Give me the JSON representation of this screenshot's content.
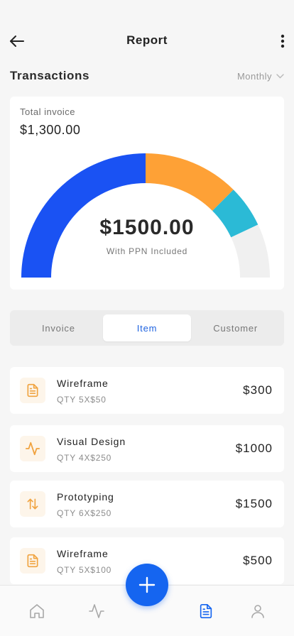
{
  "header": {
    "title": "Report",
    "back_icon": "arrow-left-icon",
    "more_icon": "more-vertical-icon"
  },
  "section": {
    "title": "Transactions",
    "period": "Monthly"
  },
  "summary": {
    "label": "Total invoice",
    "value": "$1,300.00",
    "gauge_total": "$1500.00",
    "gauge_subtitle": "With PPN Included",
    "gauge_segments": [
      {
        "fraction": 0.5,
        "color": "#1a52f3"
      },
      {
        "fraction": 0.25,
        "color": "#fea136"
      },
      {
        "fraction": 0.11,
        "color": "#2bbad6"
      },
      {
        "fraction": 0.14,
        "color": "#f0f0f0"
      }
    ]
  },
  "tabs": [
    {
      "label": "Invoice",
      "active": false
    },
    {
      "label": "Item",
      "active": true
    },
    {
      "label": "Customer",
      "active": false
    }
  ],
  "items": [
    {
      "name": "Wireframe",
      "qty": "QTY 5X$50",
      "amount": "$300",
      "icon": "document-icon"
    },
    {
      "name": "Visual Design",
      "qty": "QTY 4X$250",
      "amount": "$1000",
      "icon": "activity-icon"
    },
    {
      "name": "Prototyping",
      "qty": "QTY 6X$250",
      "amount": "$1500",
      "icon": "arrows-up-down-icon"
    },
    {
      "name": "Wireframe",
      "qty": "QTY 5X$100",
      "amount": "$500",
      "icon": "document-icon"
    }
  ],
  "nav": {
    "items": [
      "home-icon",
      "activity-icon",
      "document-icon",
      "user-icon"
    ],
    "active": "document-icon",
    "fab_icon": "plus-icon"
  },
  "colors": {
    "accent": "#1565f0",
    "icon_orange": "#f0a340",
    "active_tab": "#1f63e0"
  }
}
